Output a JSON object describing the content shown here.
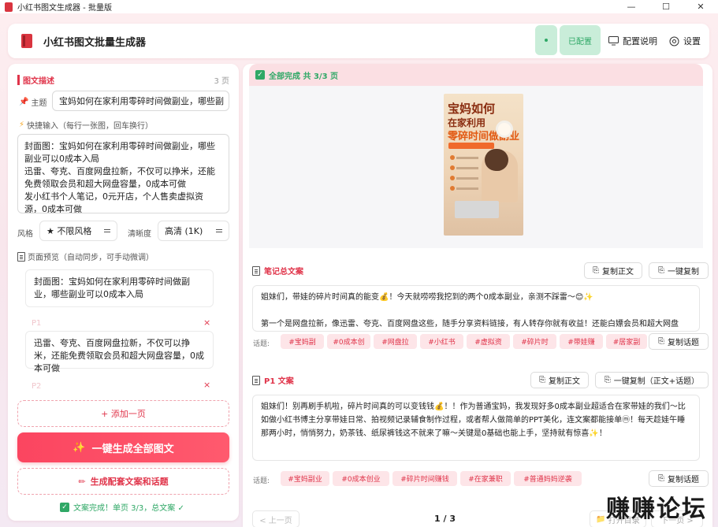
{
  "window": {
    "title": "小红书图文生成器 - 批量版",
    "controls": [
      "—",
      "☐",
      "✕"
    ]
  },
  "header": {
    "app_title": "小红书图文批量生成器",
    "status_label": "已配置",
    "config_help": "配置说明",
    "settings": "设置",
    "colors": {
      "brand": "#d9343f",
      "ok": "#2fa866",
      "accent": "#fb4560"
    }
  },
  "left": {
    "section_title": "图文描述",
    "page_count": "3 页",
    "topic_label": "主题",
    "topic_value": "宝妈如何在家利用零碎时间做副业，哪些副",
    "quick_label": "快捷输入（每行一张图，回车换行）",
    "quick_lines": [
      "封面图：宝妈如何在家利用零碎时间做副业，哪些",
      "副业可以0成本入局",
      "迅雷、夸克、百度网盘拉新，不仅可以挣米，还能",
      "免费领取会员和超大网盘容量，0成本可做",
      "发小红书个人笔记，0元开店，个人售卖虚拟资",
      "源，0成本可做"
    ],
    "style_label": "风格",
    "style_value": "★ 不限风格",
    "clarity_label": "清晰度",
    "clarity_value": "高清 (1K)",
    "preview_label": "页面预览（自动同步，可手动微调）",
    "preview_cards": [
      {
        "text": "封面图：宝妈如何在家利用零碎时间做副业，哪些副业可以0成本入局"
      },
      {
        "ghost": "P1",
        "text": "迅雷、夸克、百度网盘拉新，不仅可以挣米，还能免费领取会员和超大网盘容量，0成本可做"
      },
      {
        "ghost": "P2"
      }
    ],
    "close_mark": "×",
    "add_page": "+ 添加一页",
    "generate_all": "一键生成全部图文",
    "generate_copy": "生成配套文案和话题",
    "status_line": "文案完成！单页 3/3，总文案 ✓"
  },
  "right": {
    "done_banner": "全部完成  共 3/3 页",
    "cover": {
      "line1": "宝妈如何",
      "line2": "在家利用",
      "line3": "零碎时间做副业"
    },
    "note_section": {
      "title": "笔记总文案",
      "copy_body_btn": "复制正文",
      "copy_all_btn": "一键复制",
      "text_lines": [
        "姐妹们，带娃的碎片时间真的能变💰！今天就唠唠我挖到的两个0成本副业，亲测不踩雷～😊✨",
        "",
        "第一个是网盘拉新，像迅雷、夸克、百度网盘这些，随手分享资料链接，有人转存你就有收益！还能白嫖会员和超大网盘"
      ],
      "tags_label": "话题:",
      "tags": [
        "#宝妈副",
        "#0成本创",
        "#网盘拉",
        "#小红书",
        "#虚拟资",
        "#碎片时",
        "#带娃赚",
        "#居家副"
      ],
      "copy_tags_btn": "复制话题"
    },
    "p1_section": {
      "title": "P1 文案",
      "copy_body_btn": "复制正文",
      "copy_all_btn": "一键复制（正文+话题）",
      "text_lines": [
        "姐妹们！别再刷手机啦，碎片时间真的可以变钱钱💰！！作为普通宝妈，我发现好多0成本副业超适合在家带娃的我们～比",
        "如做小红书博主分享带娃日常、拍视频记录辅食制作过程，或者帮人做简单的PPT美化，连文案都能接单ⓜ！每天趁娃午睡",
        "那两小时，悄悄努力，奶茶钱、纸尿裤钱这不就来了嘛～关键是0基础也能上手，坚持就有惊喜✨！"
      ],
      "tags_label": "话题:",
      "tags": [
        "#宝妈副业",
        "#0成本创业",
        "#碎片时间赚钱",
        "#在家兼职",
        "#普通妈妈逆袭"
      ],
      "copy_tags_btn": "复制话题"
    },
    "pager": {
      "prev": "< 上一页",
      "page": "1 / 3",
      "open_dir": "打开目录",
      "next": "下一页 >"
    },
    "watermark": "赚赚论坛"
  }
}
